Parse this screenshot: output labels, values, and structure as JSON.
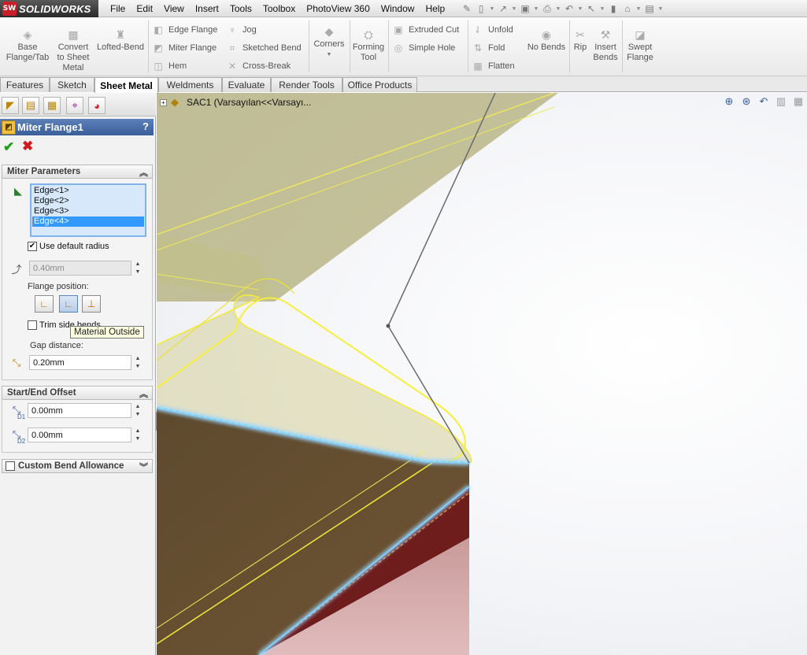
{
  "app": {
    "logo_badge": "SW",
    "logo_text": "SOLIDWORKS"
  },
  "menu": [
    "File",
    "Edit",
    "View",
    "Insert",
    "Tools",
    "Toolbox",
    "PhotoView 360",
    "Window",
    "Help"
  ],
  "ribbon": {
    "base_flange": "Base Flange/Tab",
    "convert": "Convert to Sheet Metal",
    "lofted_bend": "Lofted-Bend",
    "edge_flange": "Edge Flange",
    "miter_flange": "Miter Flange",
    "hem": "Hem",
    "jog": "Jog",
    "sketched_bend": "Sketched Bend",
    "cross_break": "Cross-Break",
    "corners": "Corners",
    "forming_tool": "Forming Tool",
    "extruded_cut": "Extruded Cut",
    "simple_hole": "Simple Hole",
    "unfold": "Unfold",
    "fold": "Fold",
    "flatten": "Flatten",
    "no_bends": "No Bends",
    "rip": "Rip",
    "insert_bends": "Insert Bends",
    "swept_flange": "Swept Flange"
  },
  "tabs": [
    "Features",
    "Sketch",
    "Sheet Metal",
    "Weldments",
    "Evaluate",
    "Render Tools",
    "Office Products"
  ],
  "active_tab": "Sheet Metal",
  "property_manager": {
    "title": "Miter Flange1",
    "help": "?",
    "ok": "✔",
    "cancel": "✖",
    "miter_parameters": {
      "header": "Miter Parameters",
      "edges": [
        "Edge<1>",
        "Edge<2>",
        "Edge<3>",
        "Edge<4>"
      ],
      "selected_edge": "Edge<4>",
      "use_default_radius_label": "Use default radius",
      "use_default_radius": true,
      "radius_value": "0.40mm",
      "flange_position_label": "Flange position:",
      "flange_position_active": "Material Outside",
      "trim_side_bends_label": "Trim side bends",
      "trim_side_bends": false,
      "tooltip": "Material Outside",
      "gap_distance_label": "Gap distance:",
      "gap_distance_value": "0.20mm"
    },
    "start_end_offset": {
      "header": "Start/End Offset",
      "d1_value": "0.00mm",
      "d2_value": "0.00mm",
      "d1_label": "D1",
      "d2_label": "D2"
    },
    "custom_bend_allowance": {
      "header": "Custom Bend Allowance",
      "checked": false
    }
  },
  "feature_tree": {
    "root": "SAC1  (Varsayılan<<Varsayı..."
  },
  "colors": {
    "accent": "#3b5e99",
    "flange": "#c8c478",
    "edge_highlight": "#6ec6ff",
    "plate": "#6a5033"
  }
}
